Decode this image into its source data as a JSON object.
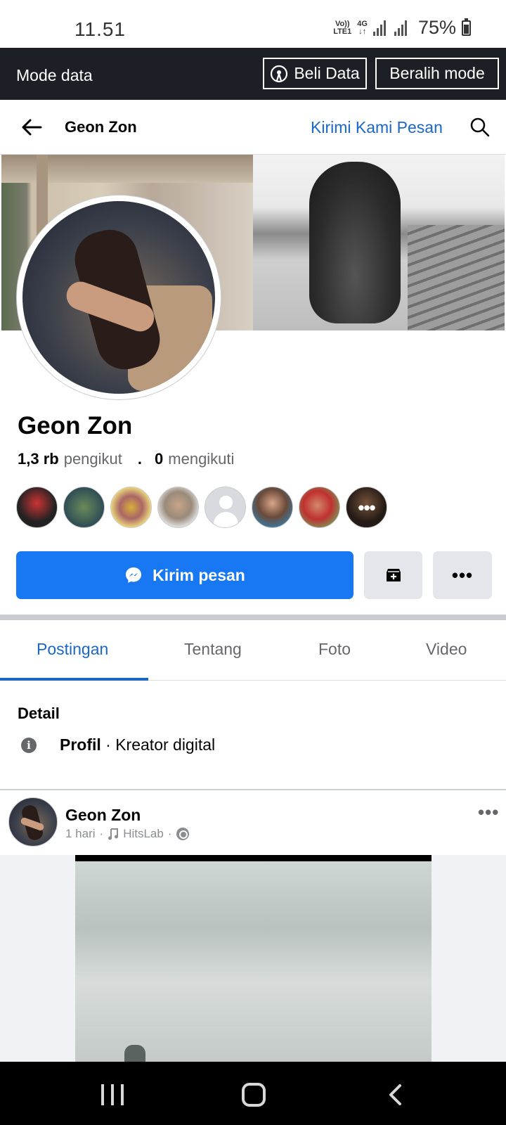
{
  "status": {
    "time": "11.51",
    "volte": "Vo)) LTE1",
    "network": "4G",
    "battery": "75%"
  },
  "mode_bar": {
    "label": "Mode data",
    "buy_button": "Beli Data",
    "switch_button": "Beralih mode"
  },
  "header": {
    "title": "Geon Zon",
    "message_link": "Kirimi Kami Pesan"
  },
  "profile": {
    "name": "Geon Zon",
    "followers_count": "1,3 rb",
    "followers_label": "pengikut",
    "separator": ".",
    "following_count": "0",
    "following_label": "mengikuti",
    "follower_avatars_more": "•••"
  },
  "actions": {
    "message_button": "Kirim pesan",
    "more_button": "•••"
  },
  "tabs": [
    {
      "label": "Postingan",
      "active": true
    },
    {
      "label": "Tentang",
      "active": false
    },
    {
      "label": "Foto",
      "active": false
    },
    {
      "label": "Video",
      "active": false
    }
  ],
  "detail": {
    "title": "Detail",
    "type_bold": "Profil",
    "type_rest": " · Kreator digital"
  },
  "post": {
    "author": "Geon Zon",
    "time": "1 hari",
    "dot": "·",
    "music": "HitsLab",
    "more": "•••"
  },
  "icons": {
    "back": "back-arrow-icon",
    "search": "search-icon",
    "broadcast": "broadcast-icon",
    "messenger": "messenger-icon",
    "save": "save-icon",
    "info": "info-icon",
    "globe": "globe-icon",
    "music": "music-note-icon"
  },
  "colors": {
    "accent": "#1877f2",
    "link": "#1b66c9",
    "mode_bar_bg": "#1c2026"
  }
}
